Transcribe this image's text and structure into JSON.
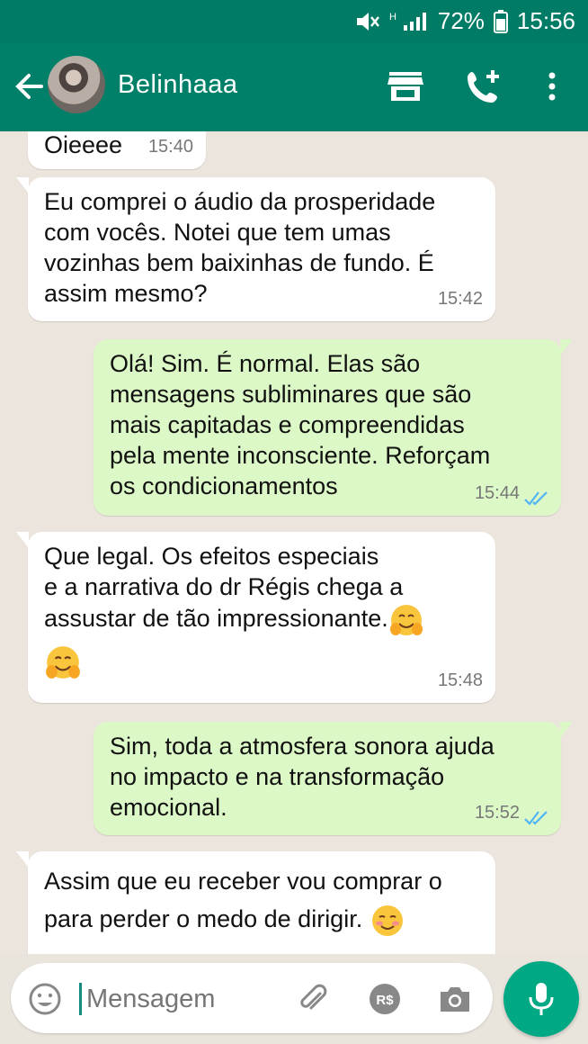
{
  "status_bar": {
    "battery": "72%",
    "time": "15:56"
  },
  "header": {
    "contact_name": "Belinhaaa",
    "icons": [
      "back-arrow-icon",
      "avatar",
      "store-icon",
      "call-add-icon",
      "more-vert-icon"
    ]
  },
  "colors": {
    "header": "#008069",
    "status": "#007b66",
    "incoming": "#ffffff",
    "outgoing": "#dcf8c6",
    "background": "#ece5dd",
    "tick_blue": "#4fb4f6",
    "mic": "#00a884"
  },
  "messages": [
    {
      "direction": "incoming",
      "text": "Oieeee",
      "time": "15:40"
    },
    {
      "direction": "incoming",
      "text": "Eu comprei o áudio da prosperidade\ncom vocês.  Notei que tem umas\nvozinhas bem baixinhas de fundo. É\nassim mesmo?",
      "time": "15:42"
    },
    {
      "direction": "outgoing",
      "text": "Olá! Sim. É normal. Elas são\nmensagens subliminares que são\nmais capitadas e compreendidas\npela mente inconsciente. Reforçam\nos condicionamentos",
      "time": "15:44",
      "read": true
    },
    {
      "direction": "incoming",
      "text": "Que legal.  Os efeitos especiais\ne a narrativa do dr Régis chega a\nassustar de tão impressionante.",
      "emoji_inline": "hugging-face",
      "emoji_line": "hugging-face",
      "time": "15:48"
    },
    {
      "direction": "outgoing",
      "text": "Sim, toda a atmosfera sonora ajuda\nno impacto e na transformação\nemocional.",
      "time": "15:52",
      "read": true
    },
    {
      "direction": "incoming",
      "text": "Assim que eu receber vou comprar o\npara perder o medo de dirigir.",
      "emoji_inline": "smiling-face"
    }
  ],
  "composer": {
    "placeholder": "Mensagem",
    "icons": [
      "emoji-icon",
      "attach-icon",
      "payment-icon",
      "camera-icon",
      "mic-icon"
    ]
  }
}
